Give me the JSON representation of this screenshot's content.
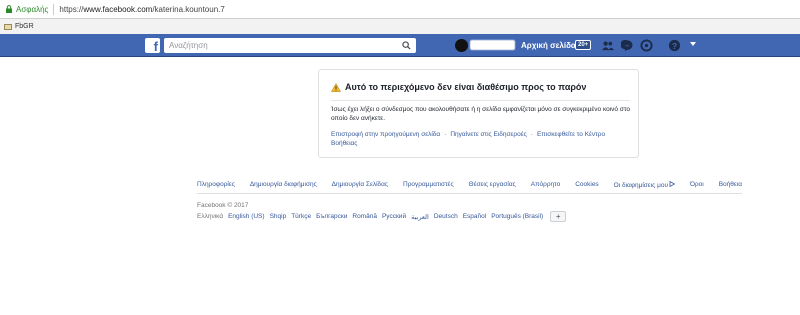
{
  "browser": {
    "secure_label": "Ασφαλής",
    "url_prefix": "https://",
    "url_domain": "www.facebook.com",
    "url_path": "/katerina.kountoun.7"
  },
  "bookmarks": [
    {
      "label": "FbGR",
      "icon": "folder-icon"
    }
  ],
  "header": {
    "logo": "f",
    "search_placeholder": "Αναζήτηση",
    "home_label": "Αρχική σελίδα",
    "home_badge": "20+",
    "icons": [
      "friends-icon",
      "messenger-icon",
      "notifications-icon",
      "help-icon",
      "chevron-down-icon"
    ]
  },
  "notice": {
    "title": "Αυτό το περιεχόμενο δεν είναι διαθέσιμο προς το παρόν",
    "body": "Ίσως έχει λήξει ο σύνδεσμος που ακολουθήσατε ή η σελίδα εμφανίζεται μόνο σε συγκεκριμένο κοινό στο οποίο δεν ανήκετε.",
    "links": [
      "Επιστροφή στην προηγούμενη σελίδα",
      "·",
      "Πηγαίνετε στις Ειδησεροές",
      "·",
      "Επισκεφθείτε το Κέντρο Βοήθειας"
    ]
  },
  "footer": {
    "links": [
      "Πληροφορίες",
      "Δημιουργία διαφήμισης",
      "Δημιουργία Σελίδας",
      "Προγραμματιστές",
      "Θέσεις εργασίας",
      "Απόρρητο",
      "Cookies",
      "Οι διαφημίσεις μου",
      "Όροι",
      "Βοήθεια"
    ],
    "copyright": "Facebook © 2017",
    "languages": [
      "Ελληνικά",
      "English (US)",
      "Shqip",
      "Türkçe",
      "Български",
      "Română",
      "Русский",
      "العربية",
      "Deutsch",
      "Español",
      "Português (Brasil)"
    ],
    "add_language": "+"
  },
  "colors": {
    "brand_blue": "#4267b2",
    "link_blue": "#365899",
    "warning_yellow": "#f7b928"
  }
}
